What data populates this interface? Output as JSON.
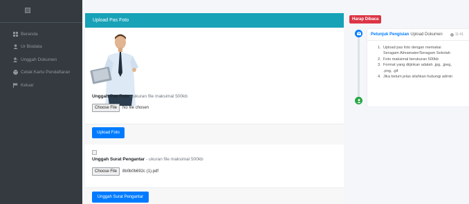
{
  "sidebar": {
    "brand_alt": "",
    "items": [
      {
        "label": "Beranda",
        "icon": "grid-icon"
      },
      {
        "label": "Ur Biodata",
        "icon": "user-icon"
      },
      {
        "label": "Unggah Dokumen",
        "icon": "user-upload-icon"
      },
      {
        "label": "Cetak Kartu Pendaftaran",
        "icon": "print-icon"
      },
      {
        "label": "Keluar",
        "icon": "flag-icon"
      }
    ]
  },
  "card": {
    "header_title": "Upload Pas Foto",
    "photo": {
      "label_bold": "Unggah Pas Foto",
      "label_hint": "- ukuran file maksimal 500kb",
      "choose_button": "Choose File",
      "file_status": "No file chosen",
      "upload_button": "Upload Foto"
    },
    "letter": {
      "label_bold": "Unggah Surat Pengantar",
      "label_hint": "- ukuran file maksimal 500kb",
      "choose_button": "Choose File",
      "file_status": "8b0b0b692c (1).pdf",
      "upload_button": "Unggah Surat Pengantar"
    }
  },
  "notice": {
    "badge": "Harap Dibaca",
    "title_strong": "Petunjuk Pengisian",
    "title_rest": "Upload Dokumen",
    "time": "11:41",
    "items": [
      "Upload pas foto dengan memakai",
      "Seragam Almamater/Seragam Sekolah",
      "Foto maksimal berukuran 500kb",
      "Format yang diijinkan adalah .jpg, .jpeg,",
      ".png, .gif",
      "Jika belum jelas silahkan hubungi admin"
    ],
    "numbers": [
      "1.",
      "",
      "2.",
      "3.",
      "",
      "4."
    ]
  },
  "colors": {
    "header_bg": "#17a2b8",
    "primary": "#007bff",
    "badge": "#dc3545",
    "sidebar_bg": "#343a40",
    "dot_blue": "#007bff",
    "dot_green": "#28a745"
  }
}
